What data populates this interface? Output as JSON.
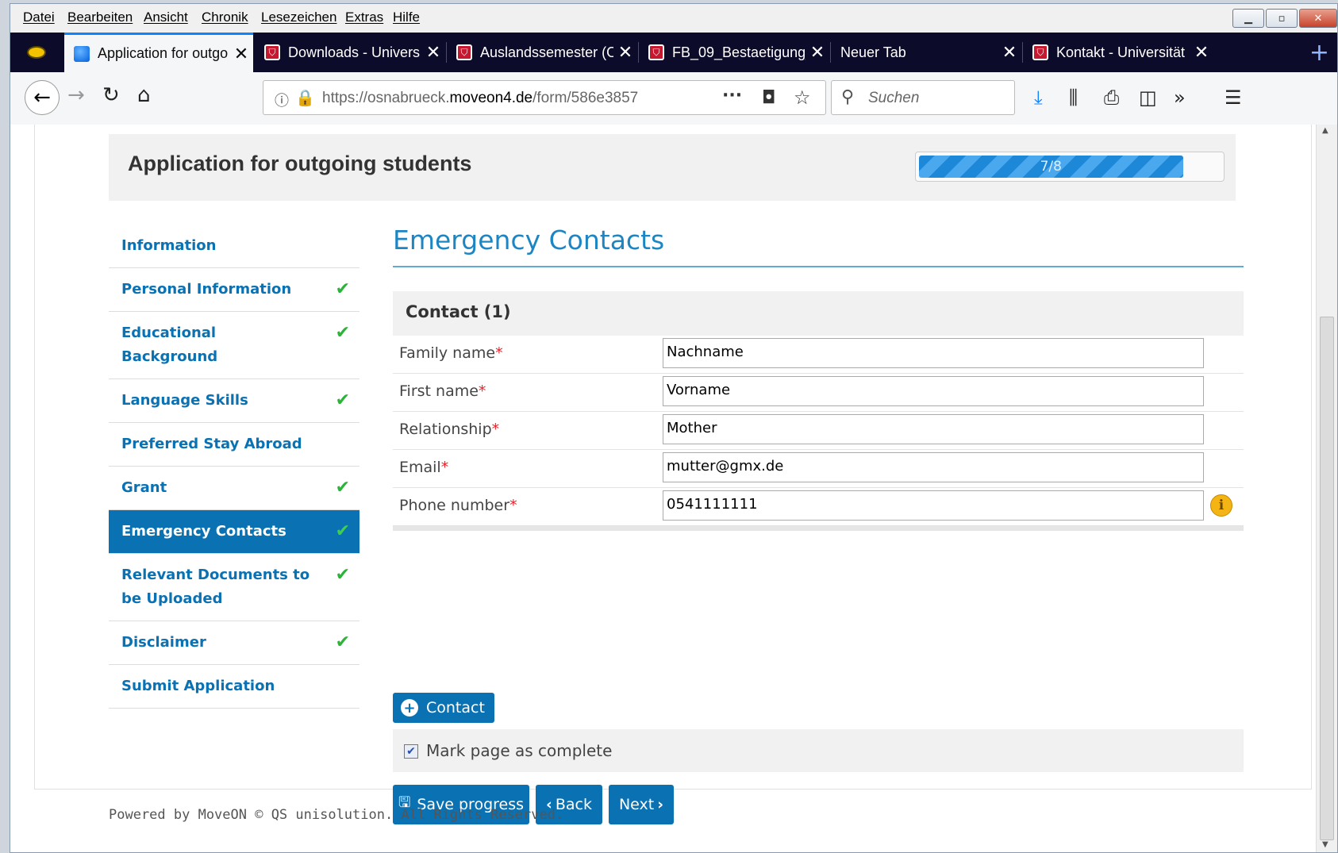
{
  "menu": [
    "Datei",
    "Bearbeiten",
    "Ansicht",
    "Chronik",
    "Lesezeichen",
    "Extras",
    "Hilfe"
  ],
  "tabs": [
    {
      "label": "Application for outgo",
      "icon": "globe-icon"
    },
    {
      "label": "Downloads - Univers",
      "icon": "shield-icon"
    },
    {
      "label": "Auslandssemester (O",
      "icon": "shield-icon"
    },
    {
      "label": "FB_09_Bestaetigung_",
      "icon": "shield-icon"
    },
    {
      "label": "Neuer Tab",
      "icon": ""
    },
    {
      "label": "Kontakt - Universität",
      "icon": "shield-icon"
    }
  ],
  "url": {
    "prefix": "https://osnabrueck.",
    "domain": "moveon4.de",
    "path": "/form/586e3857"
  },
  "search": {
    "placeholder": "Suchen"
  },
  "header": {
    "title": "Application for outgoing students",
    "progress_text": "7/8",
    "progress": 0.875
  },
  "sidebar": [
    {
      "label": "Information",
      "complete": false,
      "active": false
    },
    {
      "label": "Personal Information",
      "complete": true,
      "active": false
    },
    {
      "label": "Educational Background",
      "complete": true,
      "active": false
    },
    {
      "label": "Language Skills",
      "complete": true,
      "active": false
    },
    {
      "label": "Preferred Stay Abroad",
      "complete": false,
      "active": false
    },
    {
      "label": "Grant",
      "complete": true,
      "active": false
    },
    {
      "label": "Emergency Contacts",
      "complete": true,
      "active": true
    },
    {
      "label": "Relevant Documents to be Uploaded",
      "complete": true,
      "active": false
    },
    {
      "label": "Disclaimer",
      "complete": true,
      "active": false
    },
    {
      "label": "Submit Application",
      "complete": false,
      "active": false
    }
  ],
  "main": {
    "section_title": "Emergency Contacts",
    "contact_heading": "Contact (1)",
    "fields": [
      {
        "label": "Family name",
        "value": "Nachname"
      },
      {
        "label": "First name",
        "value": "Vorname"
      },
      {
        "label": "Relationship",
        "value": "Mother"
      },
      {
        "label": "Email",
        "value": "mutter@gmx.de"
      },
      {
        "label": "Phone number",
        "value": "0541111111"
      }
    ],
    "required_mark": "*",
    "add_contact_label": "Contact",
    "complete_label": "Mark page as complete",
    "complete_checked": true,
    "save_label": "Save progress",
    "back_label": "Back",
    "next_label": "Next"
  },
  "footer": "Powered by MoveON © QS unisolution. All Rights Reserved.",
  "colors": {
    "accent": "#0a71b3",
    "heading": "#1d86c2",
    "check": "#2db23a",
    "required": "#e0262d"
  }
}
